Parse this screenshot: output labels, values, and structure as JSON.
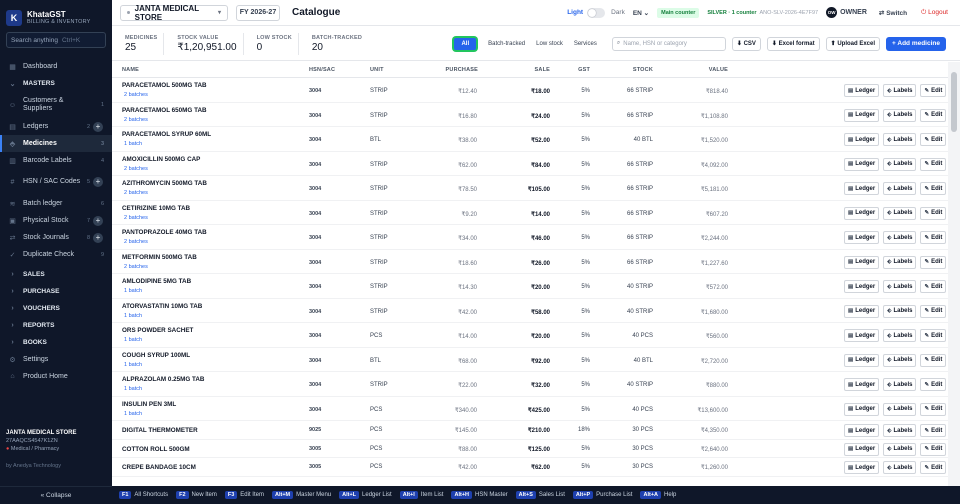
{
  "app": {
    "name": "KhataGST",
    "subtitle": "BILLING & INVENTORY",
    "logo_letter": "K"
  },
  "search": {
    "placeholder": "Search anything",
    "shortcut": "Ctrl+K"
  },
  "sidebar": {
    "items": [
      {
        "label": "Dashboard",
        "icon": "grid-icon"
      },
      {
        "label": "MASTERS",
        "icon": "chevron-down-icon",
        "group": true
      },
      {
        "label": "Customers & Suppliers",
        "icon": "people-icon",
        "num": "1"
      },
      {
        "label": "Ledgers",
        "icon": "book-icon",
        "num": "2"
      },
      {
        "label": "Medicines",
        "icon": "tag-icon",
        "num": "3"
      },
      {
        "label": "Barcode Labels",
        "icon": "barcode-icon",
        "num": "4"
      },
      {
        "label": "HSN / SAC Codes",
        "icon": "hash-icon",
        "num": "5"
      },
      {
        "label": "Batch ledger",
        "icon": "layers-icon",
        "num": "6"
      },
      {
        "label": "Physical Stock",
        "icon": "box-icon",
        "num": "7"
      },
      {
        "label": "Stock Journals",
        "icon": "swap-icon",
        "num": "8"
      },
      {
        "label": "Duplicate Check",
        "icon": "check-icon",
        "num": "9"
      },
      {
        "label": "SALES",
        "icon": "chevron-right-icon",
        "group": true
      },
      {
        "label": "PURCHASE",
        "icon": "chevron-right-icon",
        "group": true
      },
      {
        "label": "VOUCHERS",
        "icon": "chevron-right-icon",
        "group": true
      },
      {
        "label": "REPORTS",
        "icon": "chevron-right-icon",
        "group": true
      },
      {
        "label": "BOOKS",
        "icon": "chevron-right-icon",
        "group": true
      },
      {
        "label": "Settings",
        "icon": "gear-icon"
      },
      {
        "label": "Product Home",
        "icon": "home-icon"
      }
    ],
    "footer": {
      "store": "JANTA MEDICAL STORE",
      "gstin": "27AAQCS4547K1ZN",
      "type": "Medical / Pharmacy",
      "by": "by Anedya Technology"
    },
    "collapse": "« Collapse"
  },
  "topbar": {
    "store": "JANTA MEDICAL STORE",
    "fy": "FY 2026-27",
    "page_title": "Catalogue",
    "theme_light": "Light",
    "theme_dark": "Dark",
    "lang": "EN",
    "counter": "Main counter",
    "plan": "SILVER · 1 counter",
    "plan_code": "ANO-SLV-2026-4E7F97",
    "avatar": "OW",
    "user": "OWNER",
    "switch": "Switch",
    "logout": "Logout"
  },
  "stats": [
    {
      "label": "MEDICINES",
      "value": "25"
    },
    {
      "label": "STOCK VALUE",
      "value": "₹1,20,951.00"
    },
    {
      "label": "LOW STOCK",
      "value": "0"
    },
    {
      "label": "BATCH-TRACKED",
      "value": "20"
    }
  ],
  "filters": {
    "all": "All",
    "batch": "Batch-tracked",
    "low": "Low stock",
    "services": "Services"
  },
  "table_search": {
    "placeholder": "Name, HSN or category"
  },
  "toolbar": {
    "csv": "CSV",
    "excel_format": "Excel format",
    "upload_excel": "Upload Excel",
    "add": "+ Add medicine"
  },
  "columns": {
    "name": "NAME",
    "hsn": "HSN/SAC",
    "unit": "UNIT",
    "purchase": "PURCHASE",
    "sale": "SALE",
    "gst": "GST",
    "stock": "STOCK",
    "value": "VALUE"
  },
  "actions": {
    "ledger": "Ledger",
    "labels": "Labels",
    "edit": "Edit"
  },
  "rows": [
    {
      "name": "PARACETAMOL 500MG TAB",
      "batch": "2 batches",
      "hsn": "3004",
      "unit": "STRIP",
      "purchase": "₹12.40",
      "sale": "₹18.00",
      "gst": "5%",
      "stock": "66 STRIP",
      "value": "₹818.40"
    },
    {
      "name": "PARACETAMOL 650MG TAB",
      "batch": "2 batches",
      "hsn": "3004",
      "unit": "STRIP",
      "purchase": "₹16.80",
      "sale": "₹24.00",
      "gst": "5%",
      "stock": "66 STRIP",
      "value": "₹1,108.80"
    },
    {
      "name": "PARACETAMOL SYRUP 60ML",
      "batch": "1 batch",
      "hsn": "3004",
      "unit": "BTL",
      "purchase": "₹38.00",
      "sale": "₹52.00",
      "gst": "5%",
      "stock": "40 BTL",
      "value": "₹1,520.00"
    },
    {
      "name": "AMOXICILLIN 500MG CAP",
      "batch": "2 batches",
      "hsn": "3004",
      "unit": "STRIP",
      "purchase": "₹62.00",
      "sale": "₹84.00",
      "gst": "5%",
      "stock": "66 STRIP",
      "value": "₹4,092.00"
    },
    {
      "name": "AZITHROMYCIN 500MG TAB",
      "batch": "2 batches",
      "hsn": "3004",
      "unit": "STRIP",
      "purchase": "₹78.50",
      "sale": "₹105.00",
      "gst": "5%",
      "stock": "66 STRIP",
      "value": "₹5,181.00"
    },
    {
      "name": "CETIRIZINE 10MG TAB",
      "batch": "2 batches",
      "hsn": "3004",
      "unit": "STRIP",
      "purchase": "₹9.20",
      "sale": "₹14.00",
      "gst": "5%",
      "stock": "66 STRIP",
      "value": "₹607.20"
    },
    {
      "name": "PANTOPRAZOLE 40MG TAB",
      "batch": "2 batches",
      "hsn": "3004",
      "unit": "STRIP",
      "purchase": "₹34.00",
      "sale": "₹46.00",
      "gst": "5%",
      "stock": "66 STRIP",
      "value": "₹2,244.00"
    },
    {
      "name": "METFORMIN 500MG TAB",
      "batch": "2 batches",
      "hsn": "3004",
      "unit": "STRIP",
      "purchase": "₹18.60",
      "sale": "₹26.00",
      "gst": "5%",
      "stock": "66 STRIP",
      "value": "₹1,227.60"
    },
    {
      "name": "AMLODIPINE 5MG TAB",
      "batch": "1 batch",
      "hsn": "3004",
      "unit": "STRIP",
      "purchase": "₹14.30",
      "sale": "₹20.00",
      "gst": "5%",
      "stock": "40 STRIP",
      "value": "₹572.00"
    },
    {
      "name": "ATORVASTATIN 10MG TAB",
      "batch": "1 batch",
      "hsn": "3004",
      "unit": "STRIP",
      "purchase": "₹42.00",
      "sale": "₹58.00",
      "gst": "5%",
      "stock": "40 STRIP",
      "value": "₹1,680.00"
    },
    {
      "name": "ORS POWDER SACHET",
      "batch": "1 batch",
      "hsn": "3004",
      "unit": "PCS",
      "purchase": "₹14.00",
      "sale": "₹20.00",
      "gst": "5%",
      "stock": "40 PCS",
      "value": "₹560.00"
    },
    {
      "name": "COUGH SYRUP 100ML",
      "batch": "1 batch",
      "hsn": "3004",
      "unit": "BTL",
      "purchase": "₹68.00",
      "sale": "₹92.00",
      "gst": "5%",
      "stock": "40 BTL",
      "value": "₹2,720.00"
    },
    {
      "name": "ALPRAZOLAM 0.25MG TAB",
      "batch": "1 batch",
      "hsn": "3004",
      "unit": "STRIP",
      "purchase": "₹22.00",
      "sale": "₹32.00",
      "gst": "5%",
      "stock": "40 STRIP",
      "value": "₹880.00"
    },
    {
      "name": "INSULIN PEN 3ML",
      "batch": "1 batch",
      "hsn": "3004",
      "unit": "PCS",
      "purchase": "₹340.00",
      "sale": "₹425.00",
      "gst": "5%",
      "stock": "40 PCS",
      "value": "₹13,600.00"
    },
    {
      "name": "DIGITAL THERMOMETER",
      "batch": "",
      "hsn": "9025",
      "unit": "PCS",
      "purchase": "₹145.00",
      "sale": "₹210.00",
      "gst": "18%",
      "stock": "30 PCS",
      "value": "₹4,350.00"
    },
    {
      "name": "COTTON ROLL 500GM",
      "batch": "",
      "hsn": "3005",
      "unit": "PCS",
      "purchase": "₹88.00",
      "sale": "₹125.00",
      "gst": "5%",
      "stock": "30 PCS",
      "value": "₹2,640.00"
    },
    {
      "name": "CREPE BANDAGE 10CM",
      "batch": "",
      "hsn": "3005",
      "unit": "PCS",
      "purchase": "₹42.00",
      "sale": "₹62.00",
      "gst": "5%",
      "stock": "30 PCS",
      "value": "₹1,260.00"
    }
  ],
  "shortcuts": [
    {
      "key": "F1",
      "label": "All Shortcuts"
    },
    {
      "key": "F2",
      "label": "New Item"
    },
    {
      "key": "F3",
      "label": "Edit Item"
    },
    {
      "key": "Alt+M",
      "label": "Master Menu"
    },
    {
      "key": "Alt+L",
      "label": "Ledger List"
    },
    {
      "key": "Alt+I",
      "label": "Item List"
    },
    {
      "key": "Alt+H",
      "label": "HSN Master"
    },
    {
      "key": "Alt+S",
      "label": "Sales List"
    },
    {
      "key": "Alt+P",
      "label": "Purchase List"
    },
    {
      "key": "Alt+A",
      "label": "Help"
    }
  ]
}
